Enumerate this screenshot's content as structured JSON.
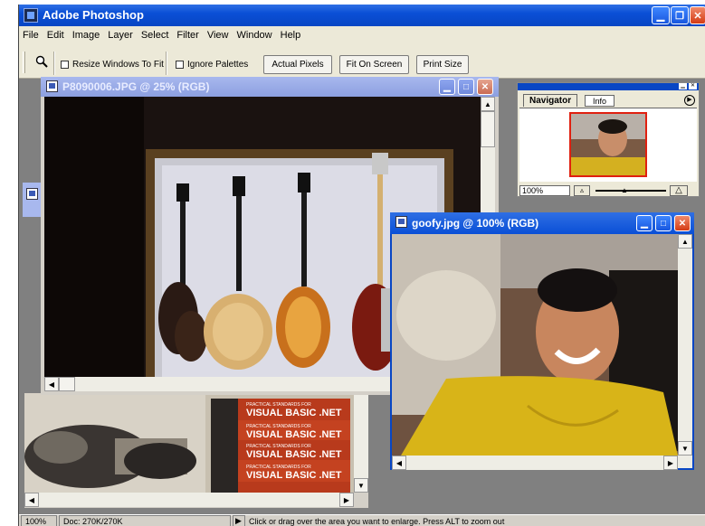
{
  "app": {
    "title": "Adobe Photoshop"
  },
  "menu": [
    "File",
    "Edit",
    "Image",
    "Layer",
    "Select",
    "Filter",
    "View",
    "Window",
    "Help"
  ],
  "options": {
    "resize_windows": "Resize Windows To Fit",
    "ignore_palettes": "Ignore Palettes",
    "actual_pixels": "Actual Pixels",
    "fit_on_screen": "Fit On Screen",
    "print_size": "Print Size"
  },
  "doc1": {
    "title": "P8090006.JPG @ 25% (RGB)"
  },
  "doc2": {
    "title": "goofy.jpg @ 100% (RGB)"
  },
  "navigator": {
    "tab_navigator": "Navigator",
    "tab_info": "Info",
    "zoom": "100%"
  },
  "books": {
    "line1": "PRACTICAL STANDARDS FOR",
    "line2": "VISUAL BASIC .NET"
  },
  "status": {
    "zoom": "100%",
    "doc": "Doc: 270K/270K",
    "hint": "Click or drag over the area you want to enlarge. Press ALT to zoom out"
  }
}
